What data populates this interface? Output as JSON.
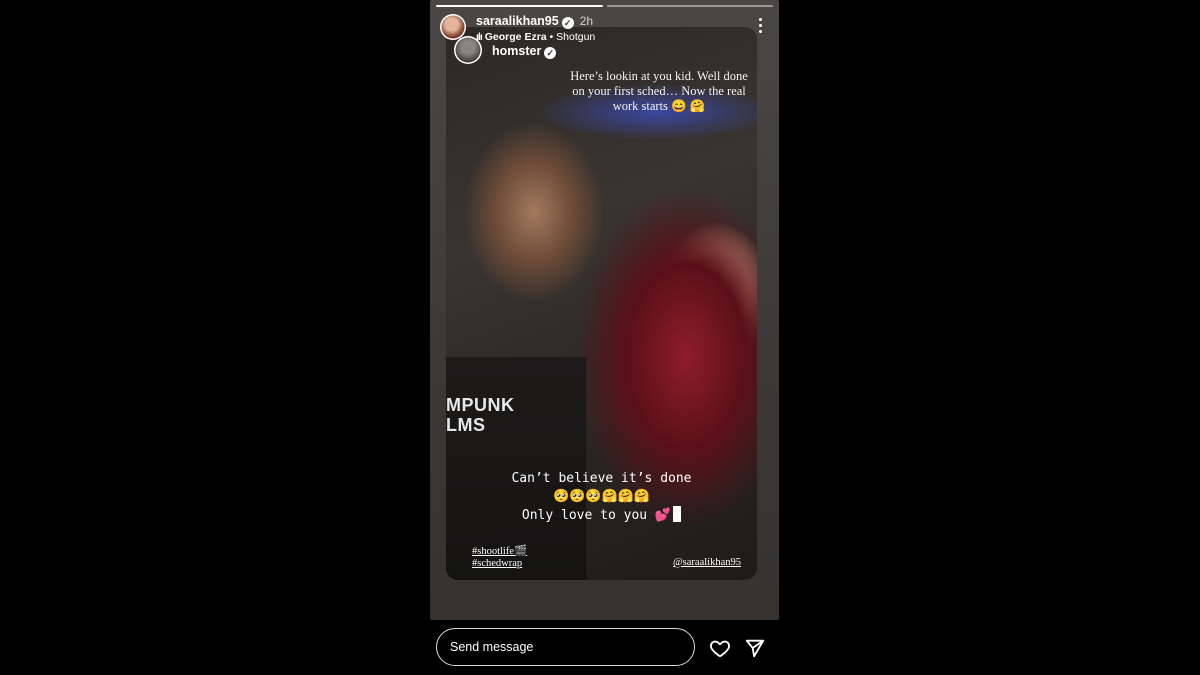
{
  "story": {
    "username": "saraalikhan95",
    "time": "2h",
    "music": {
      "artist": "George Ezra",
      "separator": "•",
      "song": "Shotgun",
      "bars": "ılı"
    },
    "progress_segments": 2,
    "progress_done": 1
  },
  "repost": {
    "username": "homster",
    "caption_top": "Here’s lookin at you kid. Well done on your first sched… Now the real work starts 😄 🤗",
    "caption_line1": "Can’t believe it’s done",
    "caption_emojis": "🥺🥺🥺🤗🤗🤗",
    "caption_line3": "Only love to you 💕",
    "tshirt_line1": "MPUNK",
    "tshirt_line2": "LMS",
    "hashtag1": "#shootlife🎬",
    "hashtag2": "#schedwrap",
    "mention": "@saraalikhan95"
  },
  "footer": {
    "message_placeholder": "Send message"
  },
  "icons": {
    "like": "heart-icon",
    "share": "send-icon",
    "more": "more-vertical-icon",
    "verified": "verified-badge-icon"
  }
}
